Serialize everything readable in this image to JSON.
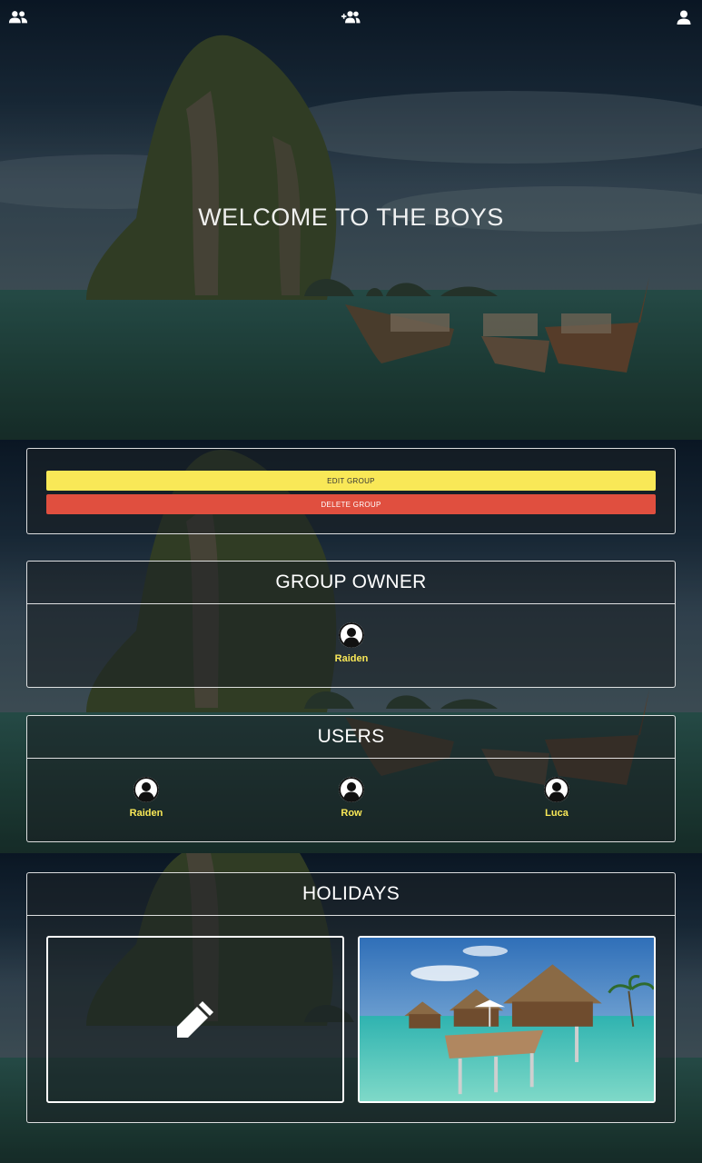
{
  "nav": {
    "groups_icon": "group-icon",
    "add_group_icon": "add-group-icon",
    "profile_icon": "user-icon"
  },
  "hero": {
    "title": "WELCOME TO THE BOYS"
  },
  "actions": {
    "edit_label": "EDIT GROUP",
    "delete_label": "DELETE GROUP"
  },
  "owner": {
    "heading": "GROUP OWNER",
    "name": "Raiden"
  },
  "users": {
    "heading": "USERS",
    "list": [
      {
        "name": "Raiden"
      },
      {
        "name": "Row"
      },
      {
        "name": "Luca"
      }
    ]
  },
  "holidays": {
    "heading": "HOLIDAYS",
    "add_icon": "pencil-icon"
  },
  "colors": {
    "accent_yellow": "#f9e857",
    "danger_red": "#e04f3f"
  }
}
